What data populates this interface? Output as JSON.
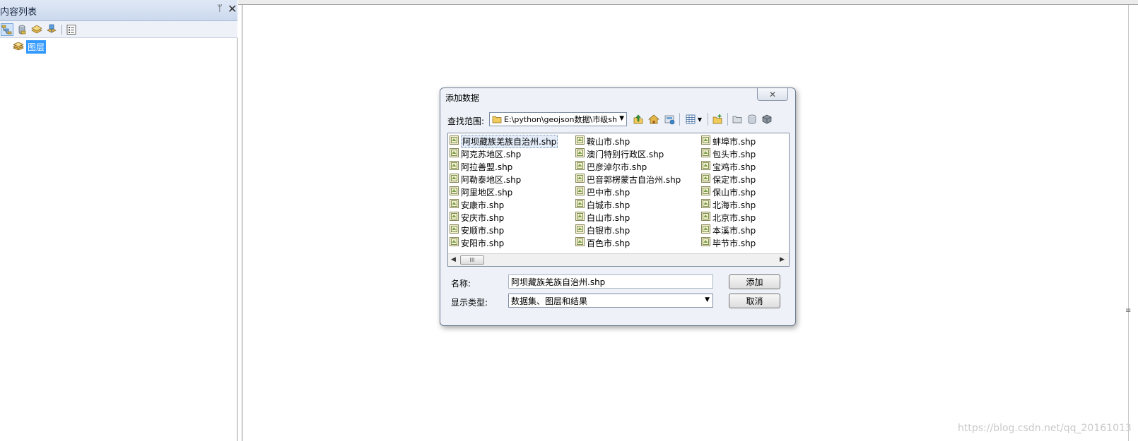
{
  "toc": {
    "title": "内容列表",
    "pin_glyph": "ᛘ",
    "close_glyph": "✕",
    "layers_label": "图层"
  },
  "map": {
    "watermark": "https://blog.csdn.net/qq_20161013",
    "grip_glyph": "≡"
  },
  "dialog": {
    "title": "添加数据",
    "close_glyph": "✕",
    "look_in_label": "查找范围:",
    "look_in_value": "E:\\python\\geojson数据\\市级sh",
    "name_label": "名称:",
    "name_value": "阿坝藏族羌族自治州.shp",
    "type_label": "显示类型:",
    "type_value": "数据集、图层和结果",
    "add_button": "添加",
    "cancel_button": "取消",
    "scroll_thumb": "III",
    "files": {
      "col1": [
        "阿坝藏族羌族自治州.shp",
        "阿克苏地区.shp",
        "阿拉善盟.shp",
        "阿勒泰地区.shp",
        "阿里地区.shp",
        "安康市.shp",
        "安庆市.shp",
        "安顺市.shp",
        "安阳市.shp"
      ],
      "col2": [
        "鞍山市.shp",
        "澳门特别行政区.shp",
        "巴彦淖尔市.shp",
        "巴音郭楞蒙古自治州.shp",
        "巴中市.shp",
        "白城市.shp",
        "白山市.shp",
        "白银市.shp",
        "百色市.shp"
      ],
      "col3": [
        "蚌埠市.shp",
        "包头市.shp",
        "宝鸡市.shp",
        "保定市.shp",
        "保山市.shp",
        "北海市.shp",
        "北京市.shp",
        "本溪市.shp",
        "毕节市.shp"
      ]
    }
  }
}
